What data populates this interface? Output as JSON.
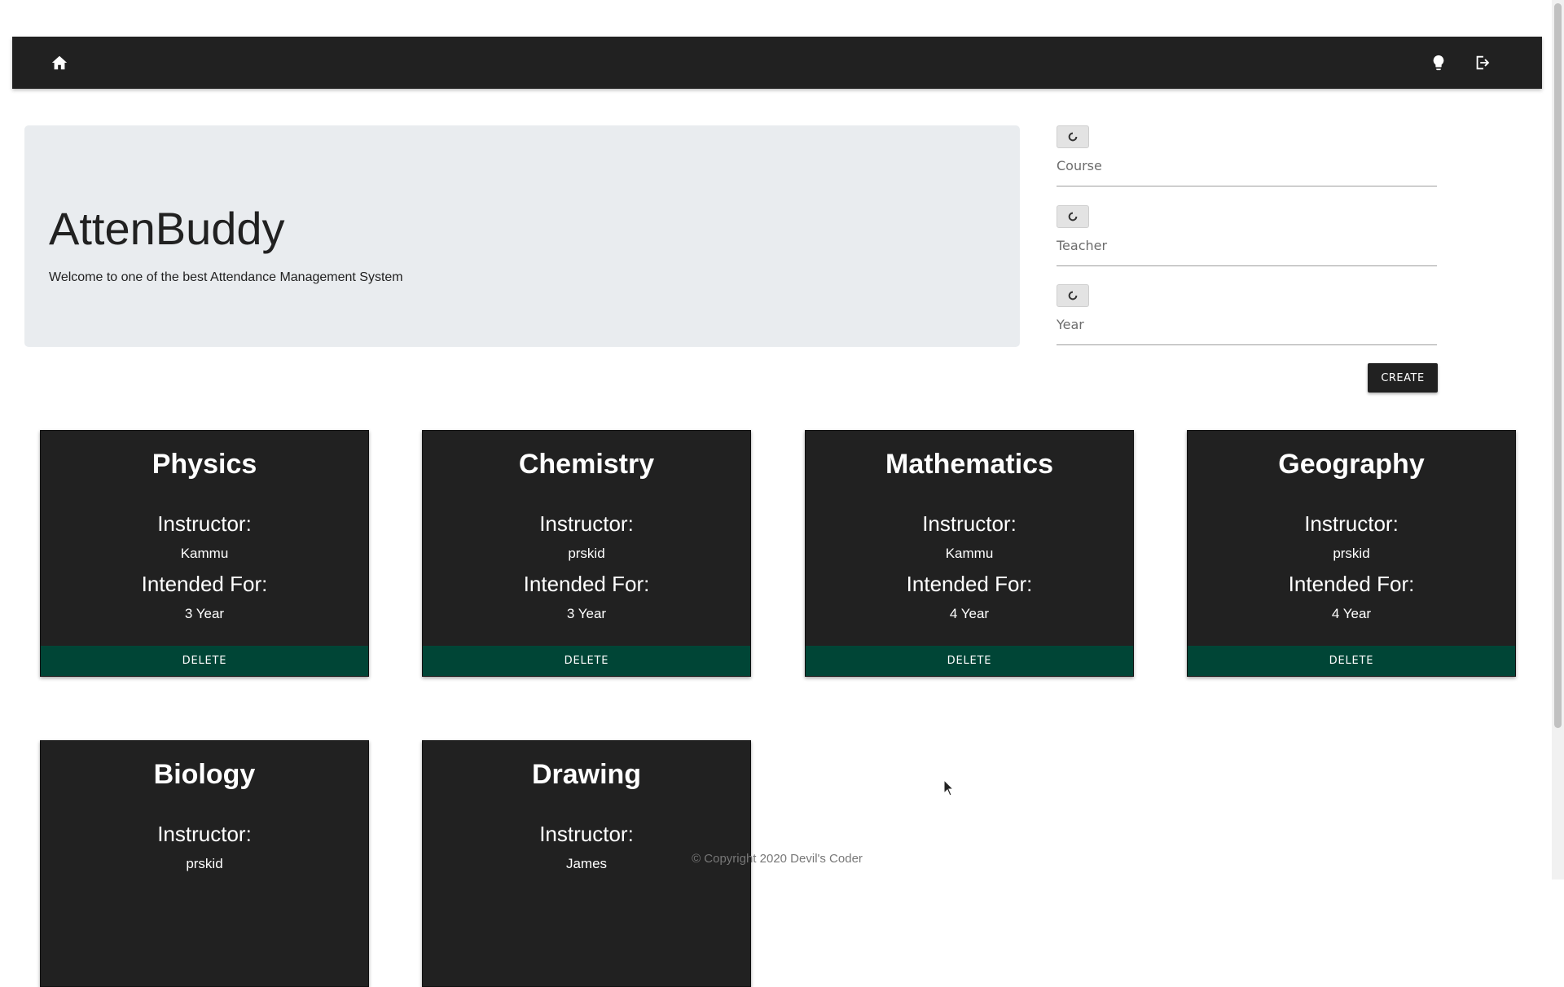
{
  "nav": {
    "icons": [
      "home-icon",
      "lightbulb-icon",
      "logout-icon"
    ]
  },
  "jumbotron": {
    "title": "AttenBuddy",
    "subtitle": "Welcome to one of the best Attendance Management System"
  },
  "form": {
    "course_label": "Course",
    "teacher_label": "Teacher",
    "year_label": "Year",
    "create_label": "CREATE"
  },
  "cards": [
    {
      "title": "Physics",
      "instructor_label": "Instructor:",
      "instructor": "Kammu",
      "for_label": "Intended For:",
      "for": "3 Year",
      "delete_label": "DELETE"
    },
    {
      "title": "Chemistry",
      "instructor_label": "Instructor:",
      "instructor": "prskid",
      "for_label": "Intended For:",
      "for": "3 Year",
      "delete_label": "DELETE"
    },
    {
      "title": "Mathematics",
      "instructor_label": "Instructor:",
      "instructor": "Kammu",
      "for_label": "Intended For:",
      "for": "4 Year",
      "delete_label": "DELETE"
    },
    {
      "title": "Geography",
      "instructor_label": "Instructor:",
      "instructor": "prskid",
      "for_label": "Intended For:",
      "for": "4 Year",
      "delete_label": "DELETE"
    },
    {
      "title": "Biology",
      "instructor_label": "Instructor:",
      "instructor": "prskid"
    },
    {
      "title": "Drawing",
      "instructor_label": "Instructor:",
      "instructor": "James"
    }
  ],
  "footer": {
    "text": "© Copyright 2020 Devil's Coder"
  },
  "colors": {
    "navbar": "#212121",
    "card": "#212121",
    "delete": "#004536",
    "jumbotron": "#e9ecef"
  }
}
